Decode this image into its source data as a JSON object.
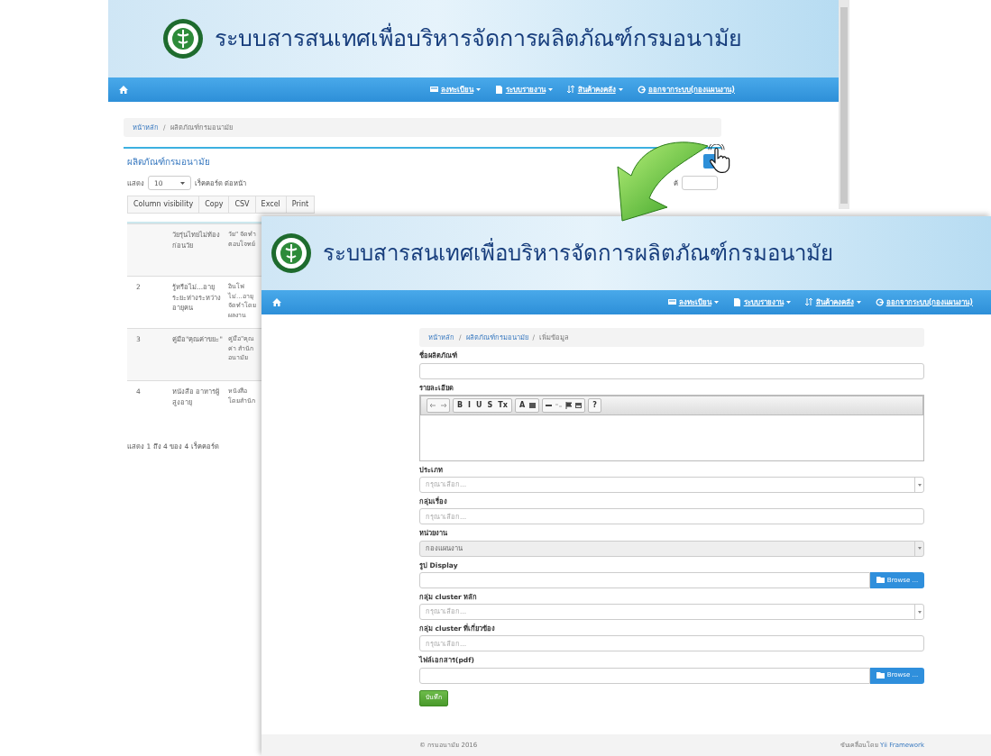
{
  "back_page": {
    "header_title": "ระบบสารสนเทศเพื่อบริหารจัดการผลิตภัณฑ์กรมอนามัย",
    "nav_items": [
      {
        "label": "ลงทะเบียน",
        "caret": true
      },
      {
        "label": "ระบบรายงาน",
        "caret": true
      },
      {
        "label": "สินค้าคงคลัง",
        "caret": true
      },
      {
        "label": "ออกจากระบบ(กองแผนงาน)",
        "caret": false
      }
    ],
    "breadcrumb": [
      {
        "label": "หน้าหลัก",
        "active": false
      },
      {
        "separator": "/",
        "label": "ผลิตภัณฑ์กรมอนามัย",
        "active": true
      }
    ],
    "panel_title": "ผลิตภัณฑ์กรมอนามัย",
    "length_before": "แสดง",
    "length_value": "10",
    "length_after": "เร็คคอร์ด ต่อหน้า",
    "search_label": "ค้",
    "buttons": [
      "Column visibility",
      "Copy",
      "CSV",
      "Excel",
      "Print"
    ],
    "rows": [
      {
        "name": "วัยรุ่นไทยไม่ท้องก่อนวัย",
        "description": "วัย\" จัดทำ ตอบโจทย์"
      },
      {
        "number": "2",
        "name": "รู้หรือไม่...อายุระยะห่างระหว่างอายุคน",
        "description": "อินโฟ ไม่...อายุ จัดทำโดย ผลงาน"
      },
      {
        "number": "3",
        "name": "คู่มือ\"คุณค่าขยะ\"",
        "description": "คู่มือ\"คุณค่า สำนักอนามัย"
      },
      {
        "number": "4",
        "name": "หนังสือ อาหารผู้สูงอายุ",
        "description": "หนังสือ โดยสำนัก"
      }
    ],
    "info": "แสดง 1 ถึง 4 ของ 4 เร็คคอร์ด"
  },
  "front_page": {
    "header_title": "ระบบสารสนเทศเพื่อบริหารจัดการผลิตภัณฑ์กรมอนามัย",
    "nav_items": [
      {
        "label": "ลงทะเบียน",
        "caret": true
      },
      {
        "label": "ระบบรายงาน",
        "caret": true
      },
      {
        "label": "สินค้าคงคลัง",
        "caret": true
      },
      {
        "label": "ออกจากระบบ(กองแผนงาน)",
        "caret": false
      }
    ],
    "breadcrumb": [
      {
        "label": "หน้าหลัก",
        "active": false
      },
      {
        "separator": "/",
        "label": "ผลิตภัณฑ์กรมอนามัย",
        "active": false
      },
      {
        "separator": "/",
        "label": "เพิ่มข้อมูล",
        "active": true
      }
    ],
    "fields": [
      {
        "kind": "text",
        "label": "ชื่อผลิตภัณฑ์"
      },
      {
        "kind": "editor",
        "label": "รายละเอียด"
      },
      {
        "kind": "select",
        "label": "ประเภท",
        "placeholder": "กรุณาเลือก...",
        "disabled": false
      },
      {
        "kind": "text",
        "label": "กลุ่มเรื่อง",
        "placeholder": "กรุณาเลือก..."
      },
      {
        "kind": "select",
        "label": "หน่วยงาน",
        "value": "กองแผนงาน",
        "disabled": true
      },
      {
        "kind": "file",
        "label": "รูป Display",
        "button": "Browse ..."
      },
      {
        "kind": "select",
        "label": "กลุ่ม cluster หลัก",
        "placeholder": "กรุณาเลือก...",
        "disabled": false
      },
      {
        "kind": "text",
        "label": "กลุ่ม cluster ที่เกี่ยวข้อง",
        "placeholder": "กรุณาเลือก..."
      },
      {
        "kind": "file",
        "label": "ไฟล์เอกสาร(pdf)",
        "button": "Browse ..."
      }
    ],
    "toolbar": [
      [
        {
          "kind": "undo"
        },
        {
          "kind": "redo"
        }
      ],
      [
        {
          "kind": "text",
          "label": "B"
        },
        {
          "kind": "text",
          "label": "I"
        },
        {
          "kind": "text",
          "label": "U"
        },
        {
          "kind": "text",
          "label": "S"
        },
        {
          "kind": "text",
          "label": "Tx"
        }
      ],
      [
        {
          "kind": "text",
          "label": "A"
        },
        {
          "kind": "bgcolor"
        }
      ],
      [
        {
          "kind": "line"
        },
        {
          "kind": "unlink"
        },
        {
          "kind": "flag"
        },
        {
          "kind": "image"
        }
      ],
      [
        {
          "kind": "text",
          "label": "?"
        }
      ]
    ],
    "submit": "บันทึก",
    "footer_left": "© กรมอนามัย 2016",
    "footer_right": "ขับเคลื่อนโดย",
    "footer_link": "Yii Framework"
  }
}
